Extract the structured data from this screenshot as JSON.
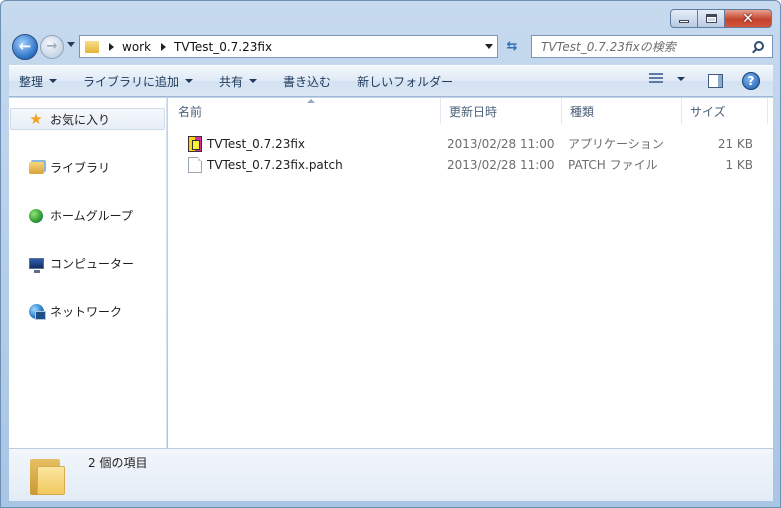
{
  "window": {
    "caption_buttons": {
      "minimize_icon": "minimize-icon",
      "maximize_icon": "maximize-icon",
      "close_icon": "close-icon",
      "close_glyph": "✕"
    }
  },
  "nav": {
    "back_glyph": "←",
    "forward_glyph": "→"
  },
  "address": {
    "crumbs": [
      "work",
      "TVTest_0.7.23fix"
    ]
  },
  "search": {
    "placeholder": "TVTest_0.7.23fixの検索"
  },
  "command_bar": {
    "items": [
      {
        "label": "整理",
        "dropdown": true
      },
      {
        "label": "ライブラリに追加",
        "dropdown": true
      },
      {
        "label": "共有",
        "dropdown": true
      },
      {
        "label": "書き込む",
        "dropdown": false
      },
      {
        "label": "新しいフォルダー",
        "dropdown": false
      }
    ],
    "help_glyph": "?"
  },
  "sidebar": {
    "items": [
      {
        "label": "お気に入り",
        "icon": "star-icon"
      },
      {
        "label": "ライブラリ",
        "icon": "library-icon"
      },
      {
        "label": "ホームグループ",
        "icon": "homegroup-icon"
      },
      {
        "label": "コンピューター",
        "icon": "computer-icon"
      },
      {
        "label": "ネットワーク",
        "icon": "network-icon"
      }
    ]
  },
  "columns": [
    "名前",
    "更新日時",
    "種類",
    "サイズ"
  ],
  "files": [
    {
      "name": "TVTest_0.7.23fix",
      "date": "2013/02/28 11:00",
      "type": "アプリケーション",
      "size": "21 KB",
      "icon": "application-icon"
    },
    {
      "name": "TVTest_0.7.23fix.patch",
      "date": "2013/02/28 11:00",
      "type": "PATCH ファイル",
      "size": "1 KB",
      "icon": "document-icon"
    }
  ],
  "details": {
    "item_count": "2 個の項目"
  }
}
